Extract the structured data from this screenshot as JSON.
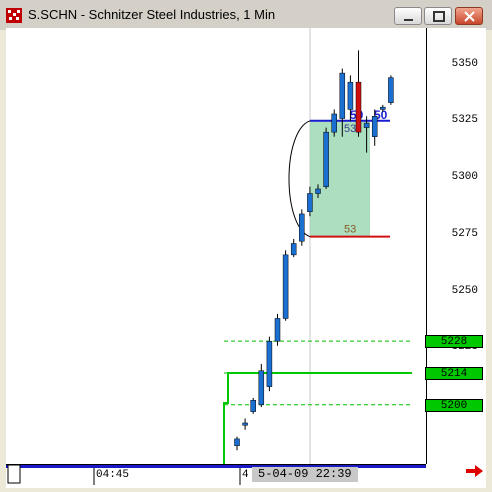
{
  "window": {
    "title": "S.SCHN - Schnitzer Steel Industries, 1 Min"
  },
  "chart_data": {
    "type": "candlestick",
    "symbol": "S.SCHN",
    "interval": "1 Min",
    "y_ticks": [
      "5350",
      "5325",
      "5300",
      "5275",
      "5250",
      "5225"
    ],
    "price_tags": [
      {
        "label": "5228",
        "value": 5228
      },
      {
        "label": "5214",
        "value": 5214
      },
      {
        "label": "5200",
        "value": 5200
      }
    ],
    "reference_lines": [
      {
        "value": 5228,
        "style": "dashed",
        "color": "#00c000"
      },
      {
        "value": 5214,
        "style": "solid",
        "color": "#00c000"
      },
      {
        "value": 5200,
        "style": "dashed",
        "color": "#00c000"
      }
    ],
    "box_annotation": {
      "low": 5274,
      "high": 5325,
      "low_label": "53",
      "high_label": "53",
      "color": "#9ed9b4"
    },
    "blue_labels": [
      "50",
      "50"
    ],
    "time_labels": [
      "04:45",
      "4"
    ],
    "cursor_date": "5-04-09  22:39",
    "candles": [
      {
        "o": 5182,
        "h": 5186,
        "l": 5180,
        "c": 5185,
        "dir": "up"
      },
      {
        "o": 5191,
        "h": 5194,
        "l": 5189,
        "c": 5192,
        "dir": "up"
      },
      {
        "o": 5197,
        "h": 5203,
        "l": 5196,
        "c": 5202,
        "dir": "up"
      },
      {
        "o": 5200,
        "h": 5218,
        "l": 5199,
        "c": 5215,
        "dir": "up"
      },
      {
        "o": 5208,
        "h": 5230,
        "l": 5206,
        "c": 5228,
        "dir": "up"
      },
      {
        "o": 5228,
        "h": 5240,
        "l": 5226,
        "c": 5238,
        "dir": "up"
      },
      {
        "o": 5238,
        "h": 5268,
        "l": 5237,
        "c": 5266,
        "dir": "up"
      },
      {
        "o": 5266,
        "h": 5273,
        "l": 5265,
        "c": 5271,
        "dir": "up"
      },
      {
        "o": 5272,
        "h": 5286,
        "l": 5270,
        "c": 5284,
        "dir": "up"
      },
      {
        "o": 5285,
        "h": 5296,
        "l": 5283,
        "c": 5293,
        "dir": "up"
      },
      {
        "o": 5293,
        "h": 5297,
        "l": 5291,
        "c": 5295,
        "dir": "up"
      },
      {
        "o": 5296,
        "h": 5322,
        "l": 5295,
        "c": 5320,
        "dir": "up"
      },
      {
        "o": 5320,
        "h": 5330,
        "l": 5318,
        "c": 5328,
        "dir": "up"
      },
      {
        "o": 5326,
        "h": 5348,
        "l": 5318,
        "c": 5346,
        "dir": "up"
      },
      {
        "o": 5330,
        "h": 5345,
        "l": 5325,
        "c": 5342,
        "dir": "up"
      },
      {
        "o": 5342,
        "h": 5356,
        "l": 5318,
        "c": 5320,
        "dir": "down"
      },
      {
        "o": 5322,
        "h": 5327,
        "l": 5311,
        "c": 5324,
        "dir": "up"
      },
      {
        "o": 5318,
        "h": 5330,
        "l": 5314,
        "c": 5327,
        "dir": "up"
      },
      {
        "o": 5330,
        "h": 5332,
        "l": 5329,
        "c": 5331,
        "dir": "up"
      },
      {
        "o": 5333,
        "h": 5345,
        "l": 5332,
        "c": 5344,
        "dir": "up"
      }
    ]
  }
}
